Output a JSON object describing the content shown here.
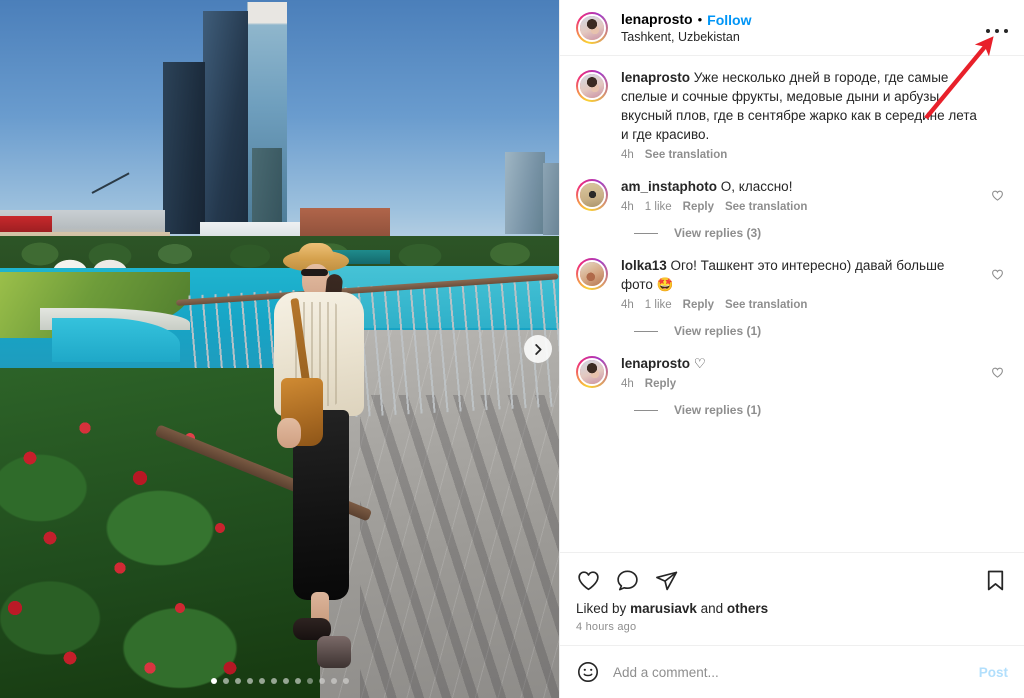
{
  "post": {
    "author": "lenaprosto",
    "separator_dot": "•",
    "follow_label": "Follow",
    "location": "Tashkent, Uzbekistan",
    "more_menu_label": "More options",
    "caption": {
      "author": "lenaprosto",
      "text": "Уже несколько дней в городе, где самые спелые и сочные фрукты, медовые дыни и арбузы, вкусный плов, где в сентябре жарко как в середине лета и где красиво.",
      "time": "4h",
      "translate_label": "See translation"
    }
  },
  "comments": [
    {
      "author": "am_instaphoto",
      "text": "О, классно!",
      "time": "4h",
      "likes": "1 like",
      "reply_label": "Reply",
      "translate_label": "See translation",
      "replies_label": "View replies (3)",
      "avatar": "av-am"
    },
    {
      "author": "lolka13",
      "text": "Ого! Ташкент это интересно) давай больше фото 🤩",
      "time": "4h",
      "likes": "1 like",
      "reply_label": "Reply",
      "translate_label": "See translation",
      "replies_label": "View replies (1)",
      "avatar": "av-lolka"
    },
    {
      "author": "lenaprosto",
      "text": "♡",
      "time": "4h",
      "likes": "",
      "reply_label": "Reply",
      "translate_label": "",
      "replies_label": "View replies (1)",
      "avatar": "av-lena"
    }
  ],
  "actions": {
    "like": "heart-icon",
    "comment": "comment-icon",
    "share": "share-icon",
    "save": "bookmark-icon",
    "liked_by_prefix": "Liked by",
    "liked_by_user": "marusiavk",
    "liked_by_middle": "and",
    "liked_by_suffix": "others",
    "timestamp": "4 hours ago"
  },
  "add_comment": {
    "emoji_icon": "emoji-smiley-icon",
    "placeholder": "Add a comment...",
    "post_label": "Post"
  },
  "media": {
    "carousel_next_icon": "chevron-right-icon",
    "dot_count": 12,
    "active_dot_index": 0
  },
  "colors": {
    "accent_blue": "#0095f6",
    "post_disabled": "#b2dffc",
    "text_primary": "#262626",
    "text_secondary": "#8e8e8e",
    "annotation_red": "#e8202a",
    "divider": "#efefef"
  }
}
